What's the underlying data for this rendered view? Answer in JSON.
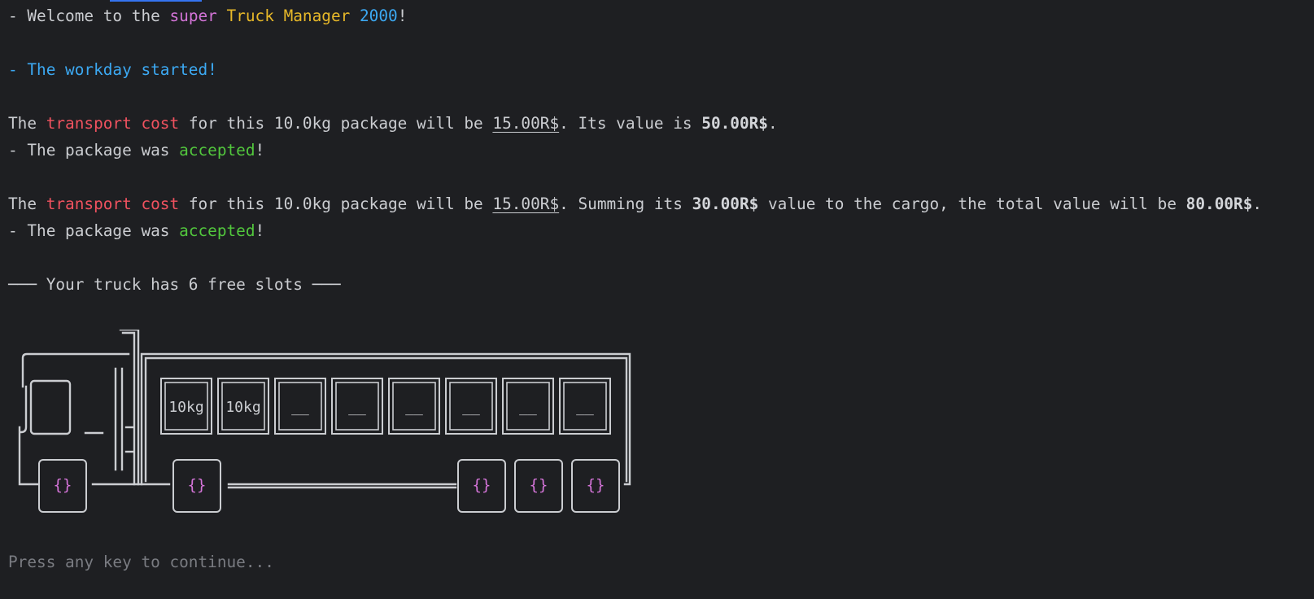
{
  "welcome": {
    "prefix": "- Welcome to the ",
    "word1": "super",
    "space1": " ",
    "word2": "Truck Manager",
    "space2": " ",
    "word3": "2000",
    "suffix": "!"
  },
  "workday": "- The workday started!",
  "msg1": {
    "a": "The ",
    "b": "transport cost",
    "c": " for this 10.0kg package will be ",
    "d": "15.00R$",
    "e": ". Its value is ",
    "f": "50.00R$",
    "g": "."
  },
  "accepted1": {
    "a": "- The package was ",
    "b": "accepted",
    "c": "!"
  },
  "msg2": {
    "a": "The ",
    "b": "transport cost",
    "c": " for this 10.0kg package will be ",
    "d": "15.00R$",
    "e": ". Summing its ",
    "f": "30.00R$",
    "g": " value to the cargo, the total value will be ",
    "h": "80.00R$",
    "i": "."
  },
  "accepted2": {
    "a": "- The package was ",
    "b": "accepted",
    "c": "!"
  },
  "slots_header": "─── Your truck has 6 free slots ───",
  "truck": {
    "slots": [
      "10kg",
      "10kg",
      "__",
      "__",
      "__",
      "__",
      "__",
      "__"
    ],
    "wheel_label": "{}"
  },
  "prompt": "Press any key to continue...",
  "colors": {
    "background": "#1e1f22",
    "text": "#cbcdd1",
    "magenta": "#d474d8",
    "yellow": "#e7b829",
    "blue": "#3ca9f3",
    "red": "#f0525f",
    "green": "#52c73d"
  }
}
